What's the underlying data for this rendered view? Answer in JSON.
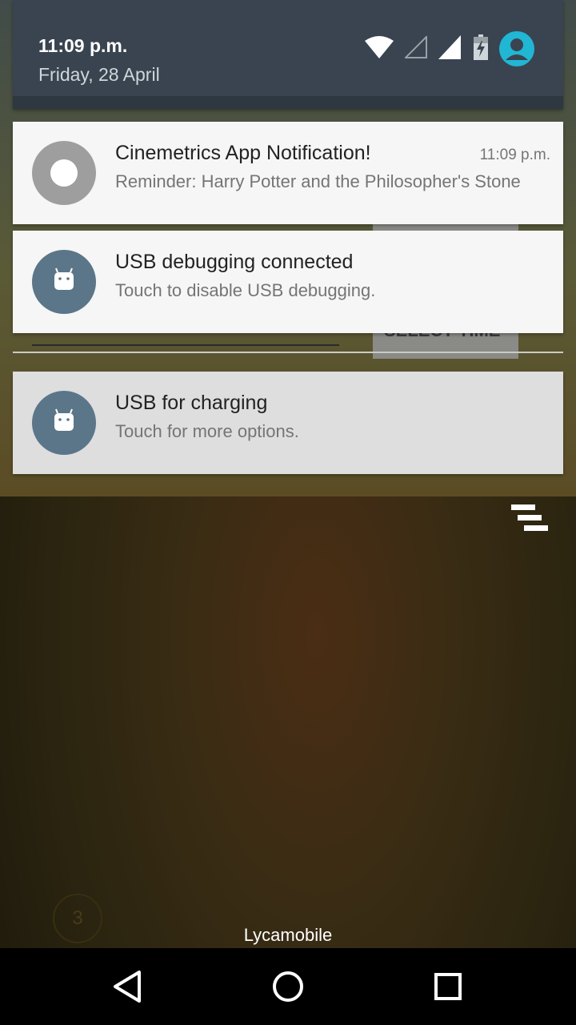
{
  "status": {
    "time": "11:09 p.m.",
    "date": "Friday, 28 April",
    "icons": [
      "wifi-icon",
      "signal-empty-icon",
      "signal-full-icon",
      "battery-charging-icon",
      "user-avatar-icon"
    ]
  },
  "background_app": {
    "button_label": "SELECT TIME"
  },
  "notifications": [
    {
      "title": "Cinemetrics App Notification!",
      "text": "Reminder: Harry Potter and the Philosopher's Stone",
      "time": "11:09 p.m.",
      "icon": "app-circle-icon"
    },
    {
      "title": "USB debugging connected",
      "text": "Touch to disable USB debugging.",
      "icon": "android-icon"
    },
    {
      "title": "USB for charging",
      "text": "Touch for more options.",
      "icon": "android-icon"
    }
  ],
  "lockscreen": {
    "carrier": "Lycamobile",
    "badge": "3"
  },
  "navbar": {
    "buttons": [
      "back-icon",
      "home-icon",
      "recents-icon"
    ]
  },
  "colors": {
    "shade": "#394450",
    "accent_avatar": "#21b6d4",
    "android_icon_bg": "#5b7689"
  }
}
